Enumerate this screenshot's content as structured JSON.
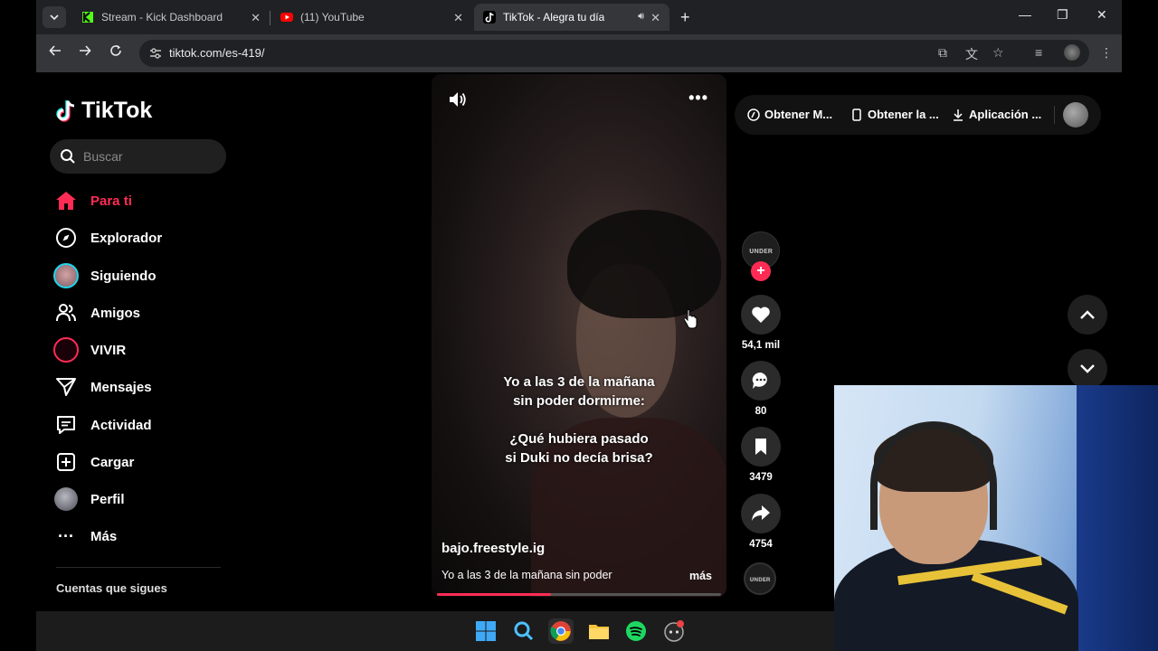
{
  "browser": {
    "tabs": [
      {
        "title": "Stream - Kick Dashboard",
        "favicon": "kick-icon",
        "active": false
      },
      {
        "title": "(11) YouTube",
        "favicon": "youtube-icon",
        "active": false
      },
      {
        "title": "TikTok - Alegra tu día",
        "favicon": "tiktok-icon",
        "active": true
      }
    ],
    "url": "tiktok.com/es-419/"
  },
  "tiktok": {
    "logo_text": "TikTok",
    "search_placeholder": "Buscar",
    "nav": [
      {
        "label": "Para ti",
        "icon": "home-icon",
        "active": true
      },
      {
        "label": "Explorador",
        "icon": "compass-icon"
      },
      {
        "label": "Siguiendo",
        "icon": "following-avatar-icon"
      },
      {
        "label": "Amigos",
        "icon": "friends-icon"
      },
      {
        "label": "VIVIR",
        "icon": "live-icon"
      },
      {
        "label": "Mensajes",
        "icon": "send-icon"
      },
      {
        "label": "Actividad",
        "icon": "activity-icon"
      },
      {
        "label": "Cargar",
        "icon": "upload-icon"
      },
      {
        "label": "Perfil",
        "icon": "profile-avatar-icon"
      },
      {
        "label": "Más",
        "icon": "more-dots-icon"
      }
    ],
    "following_title": "Cuentas que sigues",
    "header": {
      "get_coins": "Obtener M...",
      "get_app": "Obtener la ...",
      "desktop_app": "Aplicación ..."
    },
    "video": {
      "caption_line1": "Yo a las 3 de la mañana",
      "caption_line2": "sin poder dormirme:",
      "caption_line3": "¿Qué hubiera pasado",
      "caption_line4": "si Duki no decía brisa?",
      "username": "bajo.freestyle.ig",
      "description": "Yo a las 3 de la mañana sin poder",
      "more_link": "más",
      "progress": 0.4
    },
    "actions": {
      "likes": "54,1 mil",
      "comments": "80",
      "saves": "3479",
      "shares": "4754",
      "creator_avatar_text": "ᴜɴᴅᴇʀ"
    }
  },
  "colors": {
    "accent": "#fe2c55",
    "chrome_bg": "#202124",
    "toolbar_bg": "#35363a"
  }
}
